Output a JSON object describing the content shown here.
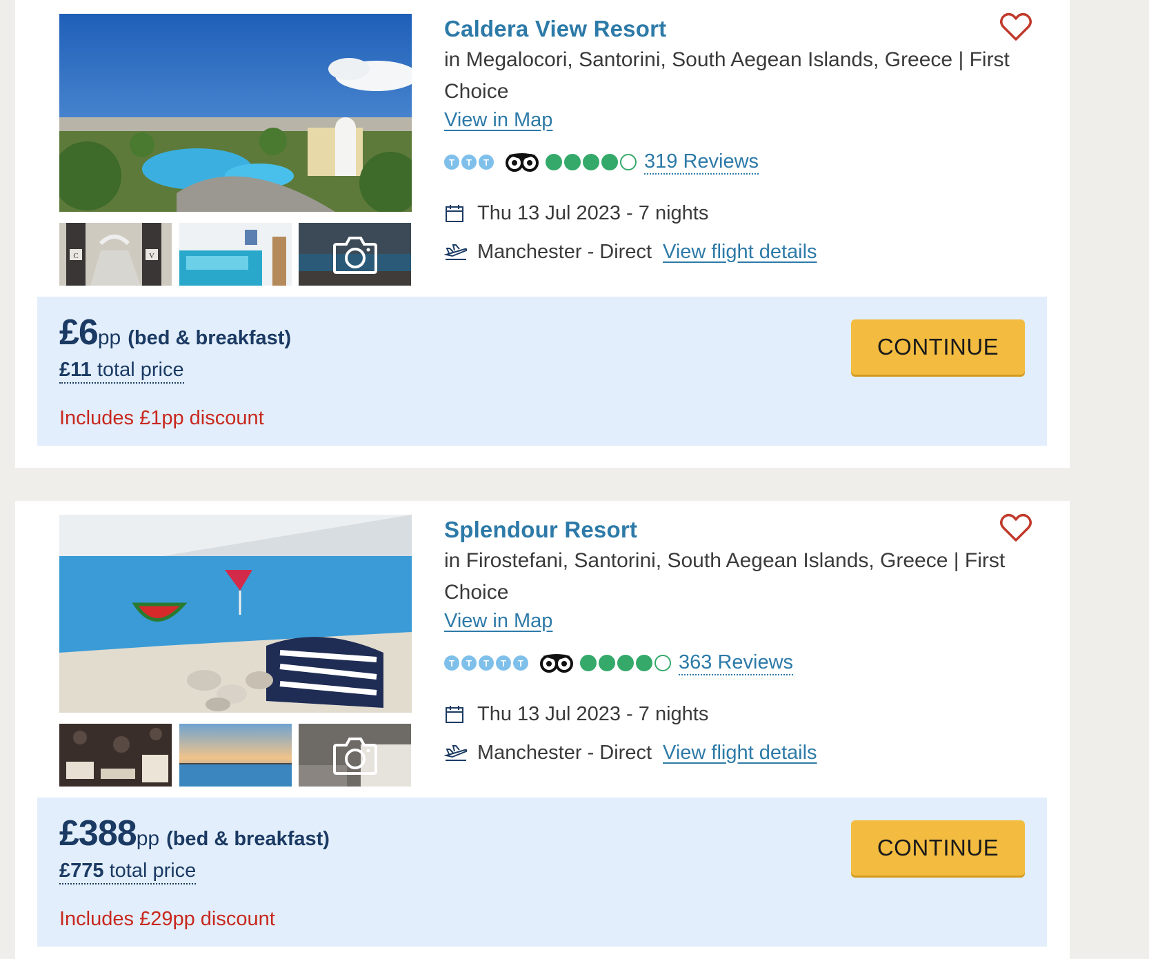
{
  "hotels": [
    {
      "name": "Caldera View Resort",
      "location": "in Megalocori, Santorini, South Aegean Islands, Greece | First Choice",
      "map_link": "View in Map",
      "official_rating": 3,
      "tripadvisor_rating": 4,
      "reviews": "319 Reviews",
      "date": "Thu 13 Jul 2023 - 7 nights",
      "flight": "Manchester - Direct",
      "flight_link": "View flight details",
      "price": "£6",
      "pp": "pp",
      "board": "(bed & breakfast)",
      "total_amount": "£11",
      "total_label": "total price",
      "discount": "Includes £1pp discount",
      "cta": "CONTINUE",
      "thumb_letters": [
        "C",
        "V"
      ]
    },
    {
      "name": "Splendour Resort",
      "location": "in Firostefani, Santorini, South Aegean Islands, Greece | First Choice",
      "map_link": "View in Map",
      "official_rating": 5,
      "tripadvisor_rating": 4,
      "reviews": "363 Reviews",
      "date": "Thu 13 Jul 2023 - 7 nights",
      "flight": "Manchester - Direct",
      "flight_link": "View flight details",
      "price": "£388",
      "pp": "pp",
      "board": "(bed & breakfast)",
      "total_amount": "£775",
      "total_label": "total price",
      "discount": "Includes £29pp discount",
      "cta": "CONTINUE"
    }
  ],
  "rating_badge_letter": "T",
  "colors": {
    "title": "#2d7aa8",
    "price": "#1b3a63",
    "discount": "#c8281e",
    "cta": "#f3bc40",
    "price_box": "#e2eefb",
    "tripadvisor": "#34a96a",
    "heart": "#c0392b"
  },
  "icons": [
    "heart-icon",
    "calendar-icon",
    "plane-icon",
    "camera-icon",
    "tripadvisor-owl-icon"
  ]
}
